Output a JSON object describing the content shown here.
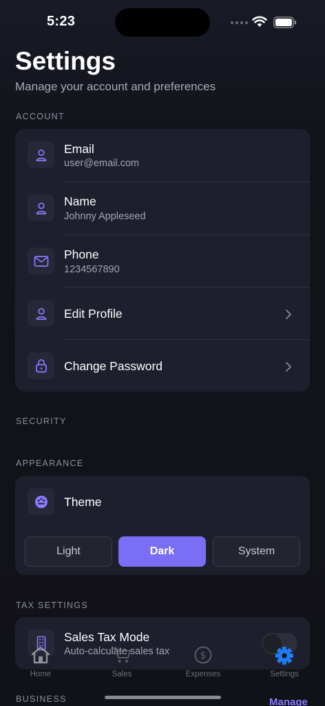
{
  "status_bar": {
    "time": "5:23"
  },
  "header": {
    "title": "Settings",
    "subtitle": "Manage your account and preferences"
  },
  "sections": {
    "account": "ACCOUNT",
    "security": "SECURITY",
    "appearance": "APPEARANCE",
    "tax": "TAX SETTINGS",
    "business": "BUSINESS"
  },
  "account": {
    "email": {
      "label": "Email",
      "value": "user@email.com",
      "icon": "person-icon"
    },
    "name": {
      "label": "Name",
      "value": "Johnny Appleseed",
      "icon": "person-icon"
    },
    "phone": {
      "label": "Phone",
      "value": "1234567890",
      "icon": "envelope-icon"
    },
    "edit_profile": {
      "label": "Edit Profile",
      "icon": "person-icon"
    },
    "change_password": {
      "label": "Change Password",
      "icon": "lock-icon"
    }
  },
  "appearance": {
    "theme_label": "Theme",
    "options": [
      "Light",
      "Dark",
      "System"
    ],
    "selected": "Dark"
  },
  "tax": {
    "sales_tax_label": "Sales Tax Mode",
    "sales_tax_sub": "Auto-calculate sales tax",
    "enabled": false
  },
  "business": {
    "manage_label": "Manage"
  },
  "tabs": [
    {
      "label": "Home",
      "icon": "house-icon"
    },
    {
      "label": "Sales",
      "icon": "cart-icon"
    },
    {
      "label": "Expenses",
      "icon": "dollar-circle-icon"
    },
    {
      "label": "Settings",
      "icon": "gear-icon"
    }
  ],
  "active_tab": "Settings",
  "colors": {
    "accent": "#7b6ef6",
    "tab_active": "#1e7cf7",
    "card": "#1d1f2c",
    "background": "#111218"
  }
}
